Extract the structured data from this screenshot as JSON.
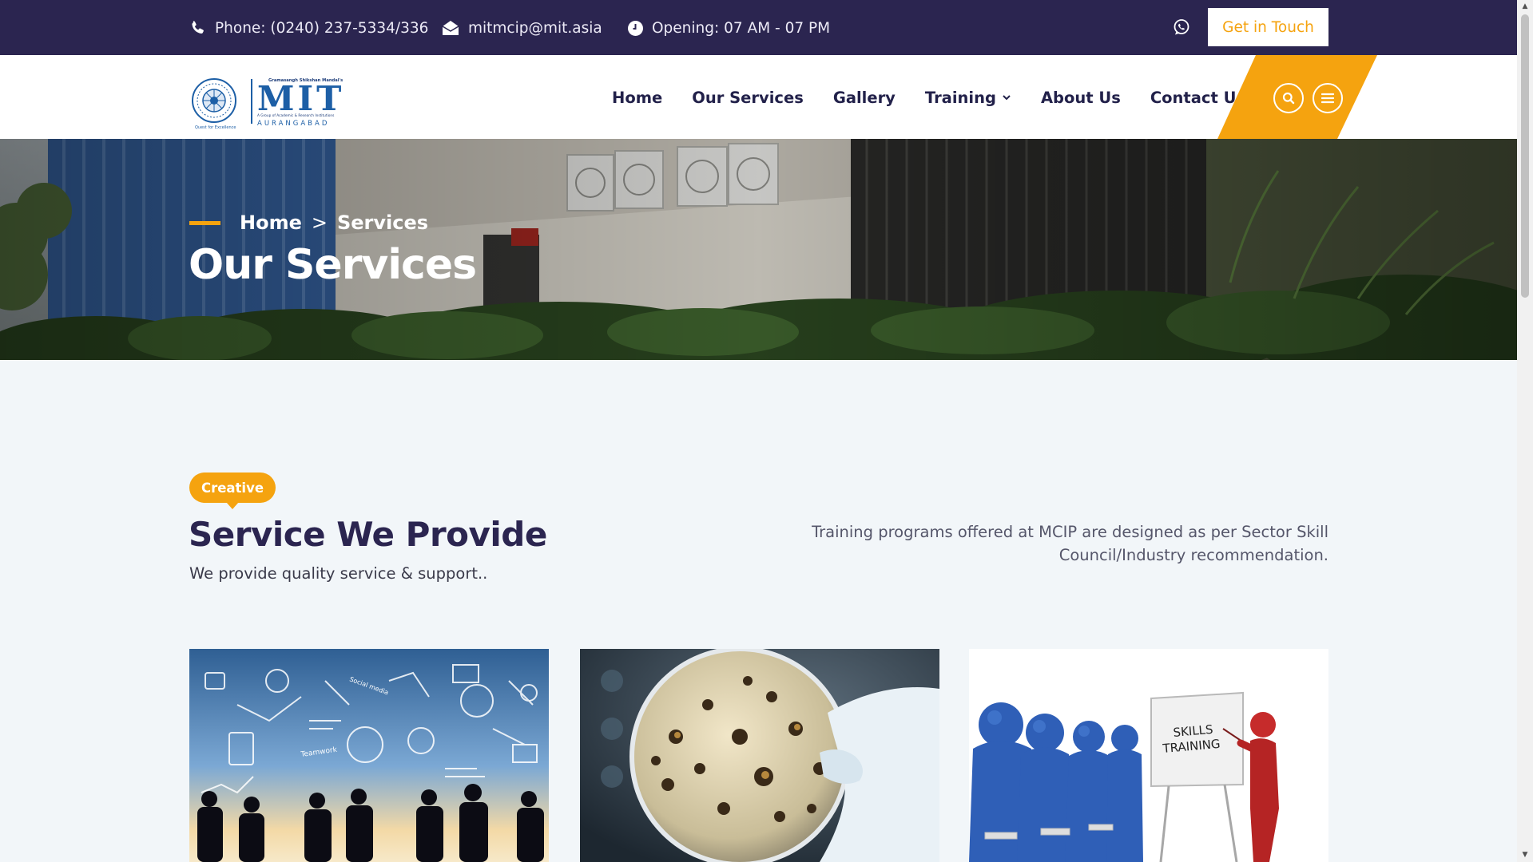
{
  "topbar": {
    "phone": "Phone: (0240) 237-5334/336",
    "email": "mitmcip@mit.asia",
    "hours": "Opening: 07 AM - 07 PM",
    "cta_label": "Get in Touch"
  },
  "logo": {
    "top_line": "Gramasangh Shikshan Mandal's",
    "brand": "MIT",
    "tagline": "A Group of Academic & Research Institutions",
    "city": "AURANGABAD",
    "motto": "Quest for Excellence"
  },
  "nav": {
    "items": [
      {
        "label": "Home"
      },
      {
        "label": "Our Services"
      },
      {
        "label": "Gallery"
      },
      {
        "label": "Training"
      },
      {
        "label": "About Us"
      },
      {
        "label": "Contact Us"
      }
    ]
  },
  "hero": {
    "breadcrumb_home": "Home",
    "breadcrumb_sep": ">",
    "breadcrumb_current": "Services",
    "title": "Our Services"
  },
  "section": {
    "badge": "Creative",
    "title": "Service We Provide",
    "subtitle": "We provide quality service & support..",
    "description": "Training programs offered at MCIP are designed as per Sector Skill Council/Industry recommendation."
  },
  "cards": {
    "skills_board_line1": "SKILLS",
    "skills_board_line2": "TRAINING",
    "doodle_word1": "Social media",
    "doodle_word2": "Teamwork"
  },
  "colors": {
    "topbar": "#2b2550",
    "accent": "#f5a30f",
    "heading": "#2b2550",
    "section_bg": "#f2f6f9"
  },
  "icons": [
    "phone-icon",
    "envelope-icon",
    "clock-icon",
    "whatsapp-icon",
    "search-icon",
    "menu-icon",
    "chevron-down-icon"
  ]
}
